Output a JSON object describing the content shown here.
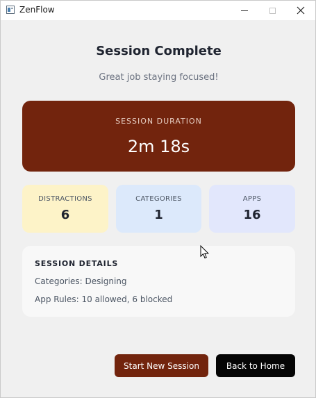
{
  "window": {
    "title": "ZenFlow",
    "app_icon": "app-window-icon",
    "controls": [
      "minimize-icon",
      "maximize-icon",
      "close-icon"
    ]
  },
  "header": {
    "title": "Session Complete",
    "subtitle": "Great job staying focused!"
  },
  "duration": {
    "label": "SESSION DURATION",
    "value": "2m 18s"
  },
  "stats": [
    {
      "label": "DISTRACTIONS",
      "value": "6",
      "color": "#fdf3c8"
    },
    {
      "label": "CATEGORIES",
      "value": "1",
      "color": "#dce9fb"
    },
    {
      "label": "APPS",
      "value": "16",
      "color": "#e2e7fc"
    }
  ],
  "details": {
    "title": "SESSION DETAILS",
    "categories_line": "Categories: Designing",
    "app_rules_line": "App Rules: 10 allowed, 6 blocked"
  },
  "actions": {
    "start_new_session": "Start New Session",
    "back_to_home": "Back to Home"
  },
  "colors": {
    "accent": "#72240d",
    "secondary_button": "#050505",
    "background": "#f0f0f0"
  }
}
